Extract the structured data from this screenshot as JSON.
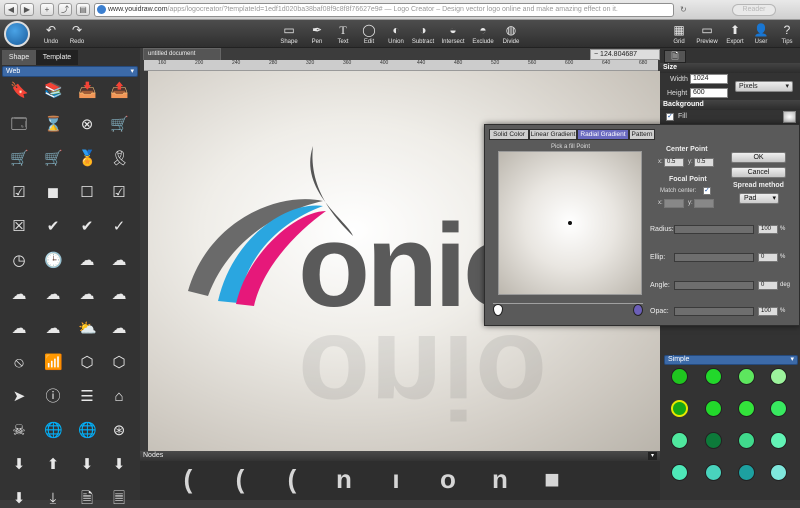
{
  "browser": {
    "url_host": "www.youidraw.com",
    "url_path": "/apps/logocreator/?templateId=1edf1d020ba38baf08f9c8f8f76627e9#",
    "page_title": " — Logo Creator – Design vector logo online and make amazing effect on it.",
    "reader_label": "Reader"
  },
  "toolbar": {
    "undo": "Undo",
    "redo": "Redo",
    "shape": "Shape",
    "pen": "Pen",
    "text": "Text",
    "edit": "Edit",
    "union": "Union",
    "subtract": "Subtract",
    "intersect": "Intersect",
    "exclude": "Exclude",
    "divide": "Divide",
    "grid": "Grid",
    "preview": "Preview",
    "export": "Export",
    "user": "User",
    "tips": "Tips"
  },
  "left_panel": {
    "tab_shape": "Shape",
    "tab_template": "Template",
    "category": "Web",
    "shapes": [
      {
        "name": "bookmark-icon",
        "glyph": "🔖"
      },
      {
        "name": "books-icon",
        "glyph": "📚"
      },
      {
        "name": "inbox-download-icon",
        "glyph": "📥"
      },
      {
        "name": "inbox-upload-icon",
        "glyph": "📤"
      },
      {
        "name": "browser-window-icon",
        "glyph": "🗔"
      },
      {
        "name": "hourglass-icon",
        "glyph": "⌛"
      },
      {
        "name": "close-circle-icon",
        "glyph": "⊗"
      },
      {
        "name": "cart-icon",
        "glyph": "🛒"
      },
      {
        "name": "cart-full-icon",
        "glyph": "🛒"
      },
      {
        "name": "cart-add-icon",
        "glyph": "🛒"
      },
      {
        "name": "award-badge-icon",
        "glyph": "🏅"
      },
      {
        "name": "ribbon-award-icon",
        "glyph": "🎗"
      },
      {
        "name": "checkbox-checked-icon",
        "glyph": "☑"
      },
      {
        "name": "stop-square-icon",
        "glyph": "◼"
      },
      {
        "name": "empty-square-icon",
        "glyph": "☐"
      },
      {
        "name": "checkbox-icon",
        "glyph": "☑"
      },
      {
        "name": "close-square-icon",
        "glyph": "☒"
      },
      {
        "name": "check-circle-icon",
        "glyph": "✔"
      },
      {
        "name": "check-mark-icon",
        "glyph": "✔"
      },
      {
        "name": "check-thin-icon",
        "glyph": "✓"
      },
      {
        "name": "clock-outline-icon",
        "glyph": "◷"
      },
      {
        "name": "clock-icon",
        "glyph": "🕒"
      },
      {
        "name": "cloud-icon",
        "glyph": "☁"
      },
      {
        "name": "cloud-refresh-icon",
        "glyph": "☁"
      },
      {
        "name": "cloud-download-icon",
        "glyph": "☁"
      },
      {
        "name": "cloud-upload-icon",
        "glyph": "☁"
      },
      {
        "name": "cloud-small-icon",
        "glyph": "☁"
      },
      {
        "name": "cloud-heart-icon",
        "glyph": "☁"
      },
      {
        "name": "cloud-gear-icon",
        "glyph": "☁"
      },
      {
        "name": "cloud-sync-icon",
        "glyph": "☁"
      },
      {
        "name": "cloud-sun-icon",
        "glyph": "⛅"
      },
      {
        "name": "cloud-flat-icon",
        "glyph": "☁"
      },
      {
        "name": "compass-icon",
        "glyph": "⦸"
      },
      {
        "name": "wifi-icon",
        "glyph": "📶"
      },
      {
        "name": "html5-icon",
        "glyph": "⬡"
      },
      {
        "name": "css3-icon",
        "glyph": "⬡"
      },
      {
        "name": "cursor-icon",
        "glyph": "➤"
      },
      {
        "name": "info-circle-icon",
        "glyph": "ⓘ"
      },
      {
        "name": "list-icon",
        "glyph": "☰"
      },
      {
        "name": "home-icon",
        "glyph": "⌂"
      },
      {
        "name": "skull-icon",
        "glyph": "☠"
      },
      {
        "name": "globe-icon",
        "glyph": "🌐"
      },
      {
        "name": "globe-grid-icon",
        "glyph": "🌐"
      },
      {
        "name": "dribbble-icon",
        "glyph": "⊛"
      },
      {
        "name": "download-tray-icon",
        "glyph": "⬇"
      },
      {
        "name": "upload-tray-icon",
        "glyph": "⬆"
      },
      {
        "name": "download-box-icon",
        "glyph": "⬇"
      },
      {
        "name": "download-arrow-icon",
        "glyph": "⬇"
      },
      {
        "name": "download-icon",
        "glyph": "⬇"
      },
      {
        "name": "download-line-icon",
        "glyph": "⤓"
      },
      {
        "name": "document-icon",
        "glyph": "🗎"
      },
      {
        "name": "document-lines-icon",
        "glyph": "🗏"
      }
    ]
  },
  "document": {
    "tab_title": "untitled document",
    "zoom": "124.804687",
    "ruler_ticks": [
      "160",
      "200",
      "240",
      "280",
      "320",
      "360",
      "400",
      "440",
      "480",
      "520",
      "560",
      "600",
      "640",
      "680"
    ],
    "logo_text": "onio"
  },
  "right_panel": {
    "size_header": "Size",
    "width_label": "Width",
    "width_value": "1024",
    "height_label": "Height",
    "height_value": "600",
    "unit": "Pixels",
    "background_header": "Background",
    "fill_label": "Fill",
    "palette_name": "Simple",
    "swatches": [
      "#1fc61f",
      "#22d82b",
      "#5de65e",
      "#9cf39c",
      "#16a816",
      "#22d82b",
      "#33e33b",
      "#38e960",
      "#4fe89e",
      "#0d7a3a",
      "#40d98c",
      "#62f3b5",
      "#4ee8b8",
      "#49d3bd",
      "#1da0a0",
      "#7fe7dc"
    ]
  },
  "gradient_dialog": {
    "tabs": [
      "Solid Color",
      "Linear Gradient",
      "Radial Gradient",
      "Pattern"
    ],
    "active_tab": 2,
    "pick_label": "Pick a fill Point",
    "center_point_label": "Center Point",
    "cx_label": "x:",
    "cx_value": "0.5",
    "cy_label": "y:",
    "cy_value": "0.5",
    "focal_point_label": "Focal Point",
    "match_center_label": "Match center:",
    "fx_label": "x:",
    "fy_label": "y:",
    "ok_label": "OK",
    "cancel_label": "Cancel",
    "spread_label": "Spread method",
    "spread_value": "Pad",
    "radius_label": "Radius:",
    "radius_value": "100",
    "radius_unit": "%",
    "ellip_label": "Ellip:",
    "ellip_value": "0",
    "ellip_unit": "%",
    "angle_label": "Angle:",
    "angle_value": "0",
    "angle_unit": "deg",
    "opac_label": "Opac:",
    "opac_value": "100",
    "opac_unit": "%"
  },
  "nodes_panel": {
    "title": "Nodes",
    "nodes": [
      "(",
      "(",
      "(",
      "n",
      "ı",
      "o",
      "n",
      "■",
      ""
    ]
  }
}
